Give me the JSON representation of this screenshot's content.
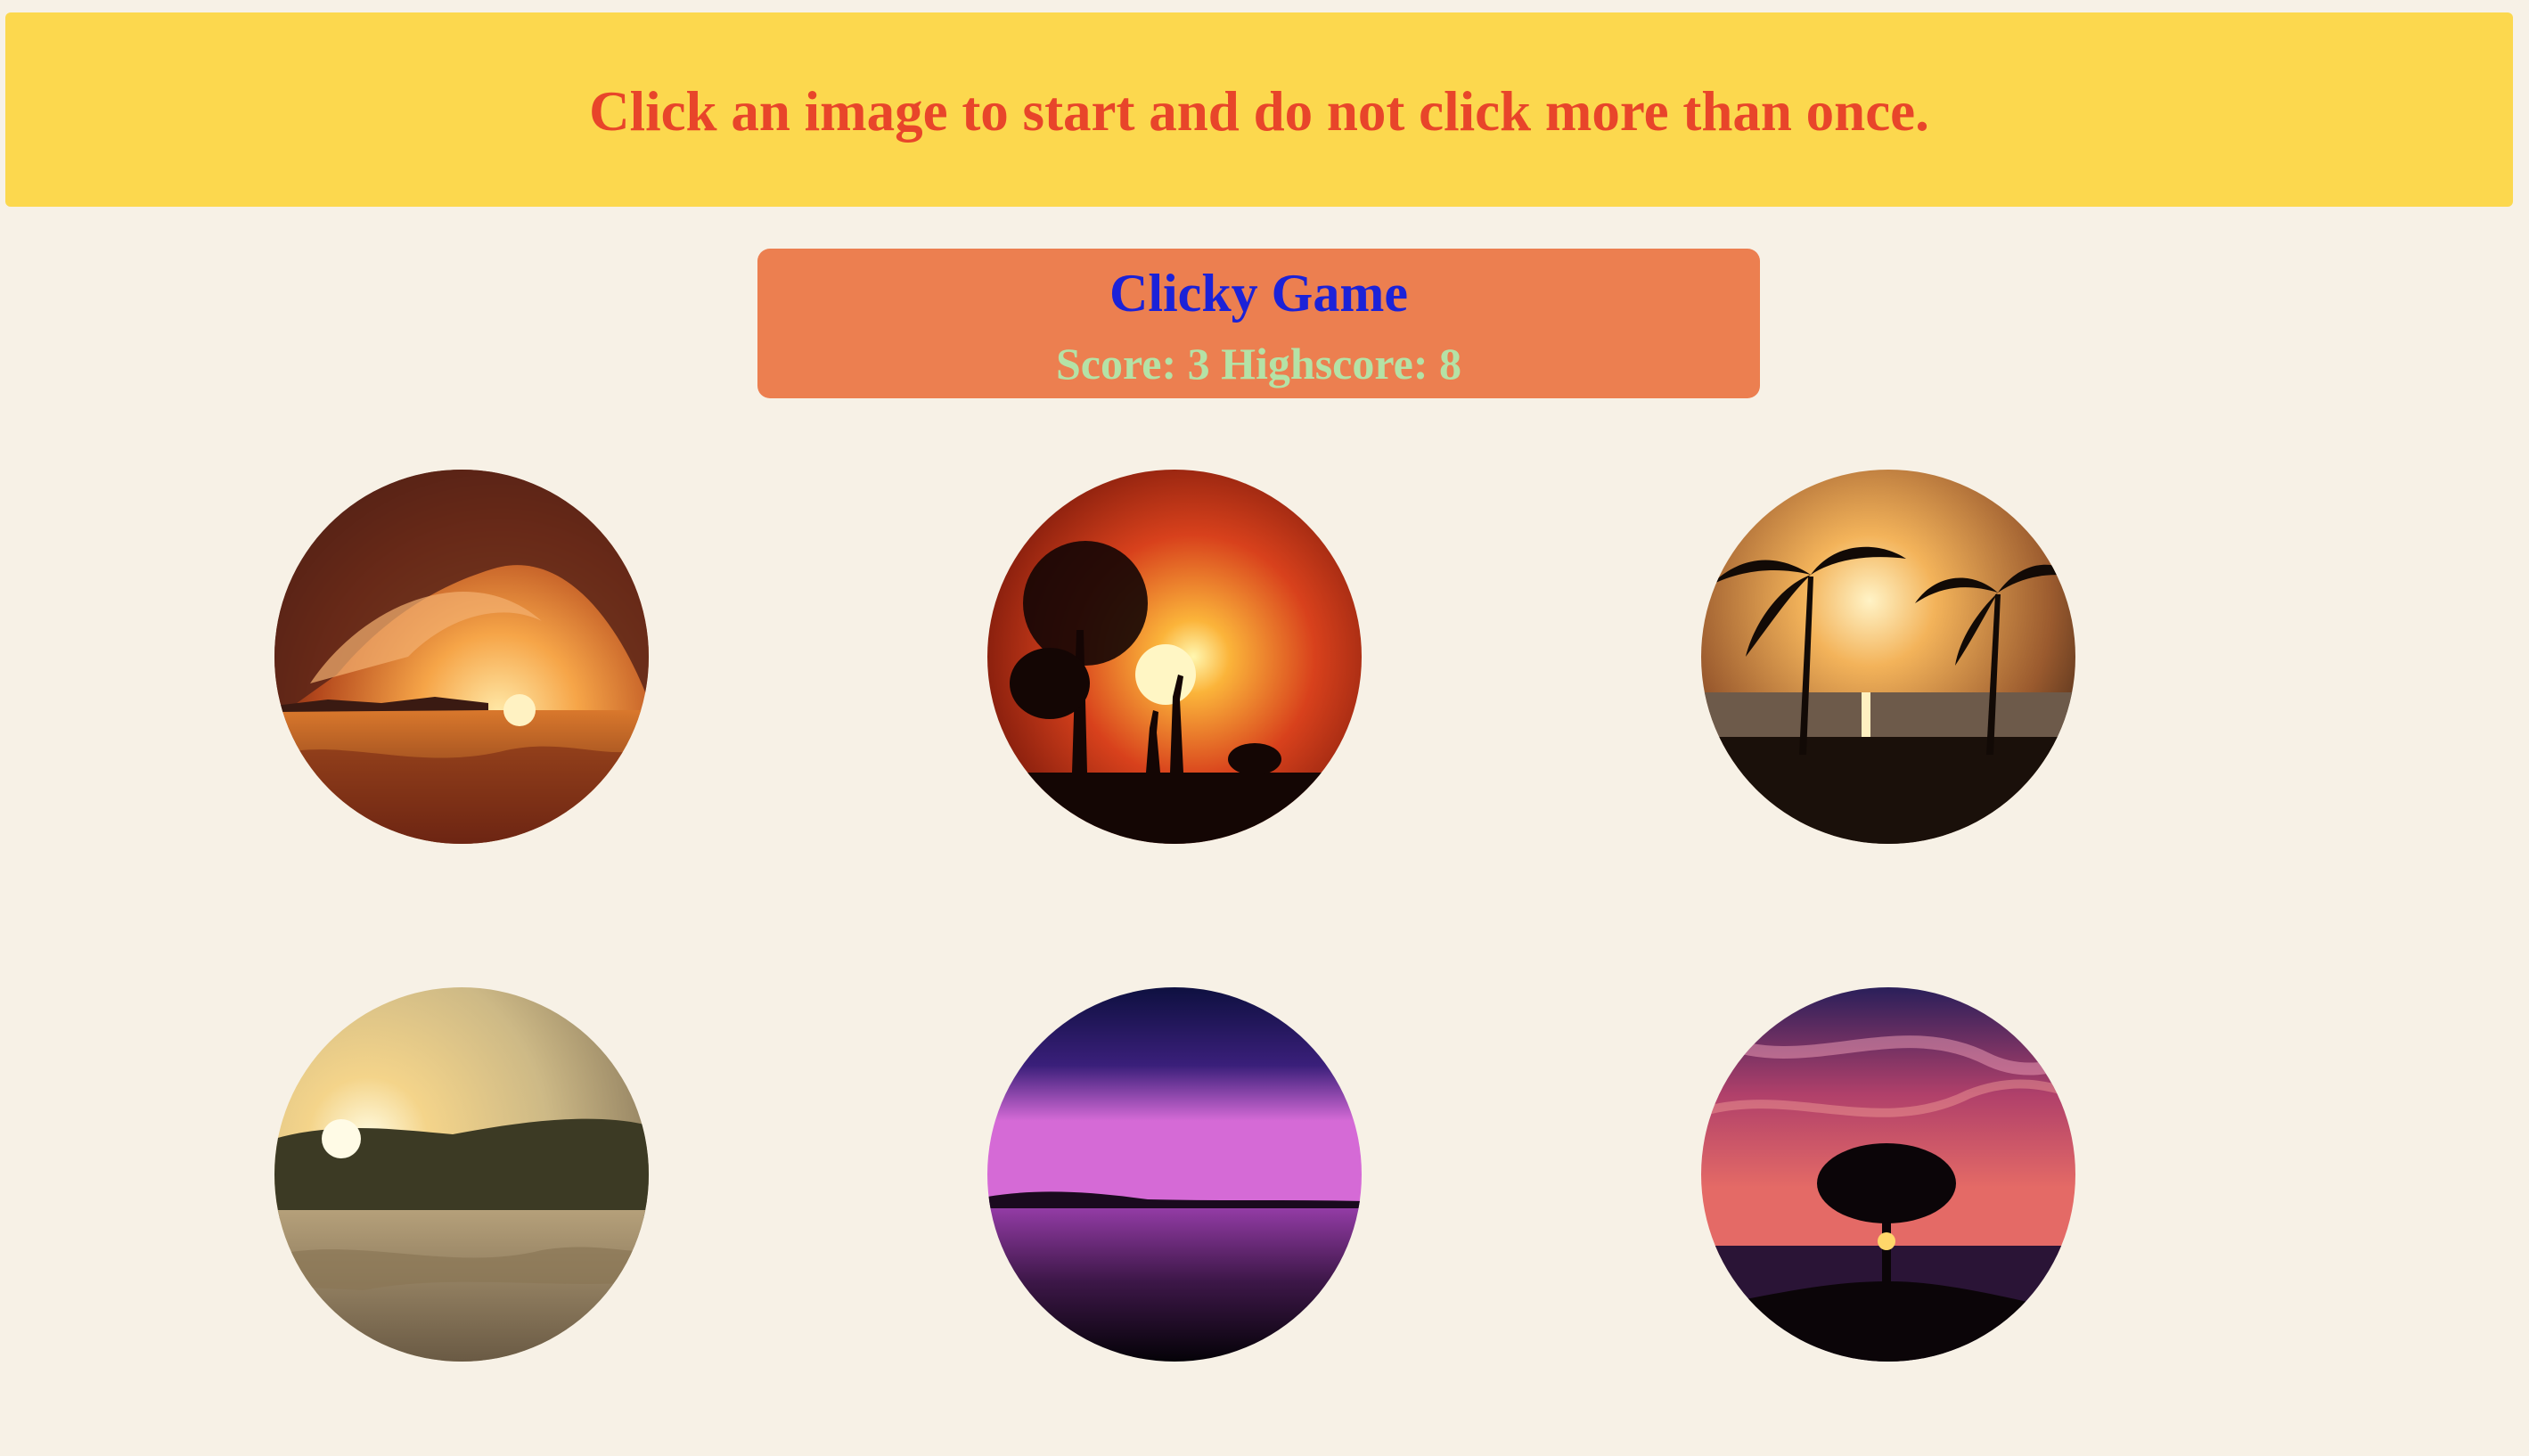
{
  "banner": {
    "message": "Click an image to start and do not click more than once."
  },
  "scoreboard": {
    "title": "Clicky Game",
    "score_label": "Score:",
    "score": 3,
    "highscore_label": "Highscore:",
    "highscore": 8
  },
  "images": [
    {
      "subject": "ocean wave curl at sunset",
      "accent": "#f08a2a"
    },
    {
      "subject": "savanna silhouette with giraffes and elephant at sunset",
      "accent": "#d0391a"
    },
    {
      "subject": "palm trees on beach at sunset",
      "accent": "#e2852a"
    },
    {
      "subject": "sun over rocky river bank",
      "accent": "#e9c466"
    },
    {
      "subject": "purple dusk over calm lake",
      "accent": "#8a2fb0"
    },
    {
      "subject": "lone tree under pink sky by the sea",
      "accent": "#c83f6e"
    }
  ],
  "colors": {
    "page_background": "#f7f1e6",
    "banner_background": "#fcd84e",
    "banner_text": "#e8452a",
    "scoreboard_background": "#ec7f50",
    "title_text": "#1b22d8",
    "score_text": "#b4e2a6"
  }
}
